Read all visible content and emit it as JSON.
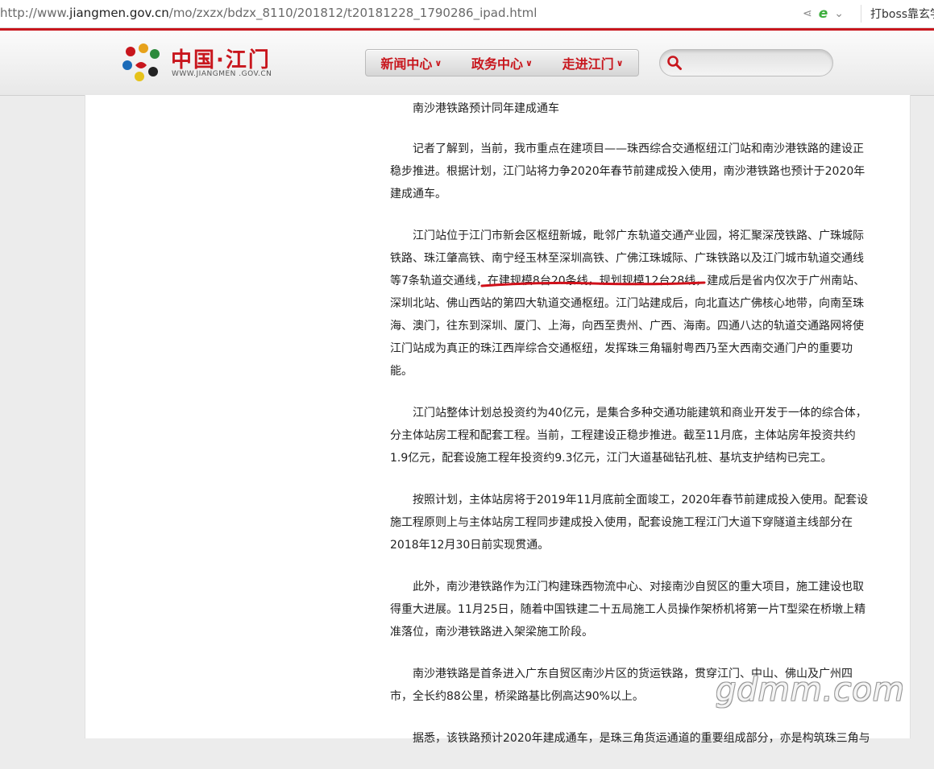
{
  "browser": {
    "url_prefix": "http://www.",
    "url_host": "jiangmen.gov.cn",
    "url_path": "/mo/zxzx/bdzx_8110/201812/t20181228_1790286_ipad.html",
    "right_tab_text": "打boss靠玄学"
  },
  "site": {
    "logo_cn": "中国·江门",
    "logo_en": "WWW.JIANGMEN .GOV.CN",
    "nav": [
      {
        "label": "新闻中心"
      },
      {
        "label": "政务中心"
      },
      {
        "label": "走进江门"
      }
    ],
    "search": {
      "placeholder": ""
    }
  },
  "article": {
    "paragraphs": [
      "南沙港铁路预计同年建成通车",
      "记者了解到，当前，我市重点在建项目——珠西综合交通枢纽江门站和南沙港铁路的建设正稳步推进。根据计划，江门站将力争2020年春节前建成投入使用，南沙港铁路也预计于2020年建成通车。",
      "江门站位于江门市新会区枢纽新城，毗邻广东轨道交通产业园，将汇聚深茂铁路、广珠城际铁路、珠江肇高铁、南宁经玉林至深圳高铁、广佛江珠城际、广珠铁路以及江门城市轨道交通线等7条轨道交通线，在建规模8台20条线，规划规模12台28线，建成后是省内仅次于广州南站、深圳北站、佛山西站的第四大轨道交通枢纽。江门站建成后，向北直达广佛核心地带，向南至珠海、澳门，往东到深圳、厦门、上海，向西至贵州、广西、海南。四通八达的轨道交通路网将使江门站成为真正的珠江西岸综合交通枢纽，发挥珠三角辐射粤西乃至大西南交通门户的重要功能。",
      "江门站整体计划总投资约为40亿元，是集合多种交通功能建筑和商业开发于一体的综合体，分主体站房工程和配套工程。当前，工程建设正稳步推进。截至11月底，主体站房年投资共约1.9亿元，配套设施工程年投资约9.3亿元，江门大道基础钻孔桩、基坑支护结构已完工。",
      "按照计划，主体站房将于2019年11月底前全面竣工，2020年春节前建成投入使用。配套设施工程原则上与主体站房工程同步建成投入使用，配套设施工程江门大道下穿隧道主线部分在2018年12月30日前实现贯通。",
      "此外，南沙港铁路作为江门构建珠西物流中心、对接南沙自贸区的重大项目，施工建设也取得重大进展。11月25日，随着中国铁建二十五局施工人员操作架桥机将第一片T型梁在桥墩上精准落位，南沙港铁路进入架梁施工阶段。",
      "南沙港铁路是首条进入广东自贸区南沙片区的货运铁路，贯穿江门、中山、佛山及广州四市，全长约88公里，桥梁路基比例高达90%以上。",
      "据悉，该铁路预计2020年建成通车，是珠三角货运通道的重要组成部分，亦是构筑珠三角与"
    ]
  },
  "watermark": "gdmm.com",
  "colors": {
    "brand_red": "#c8161d",
    "annotation_red": "#d0101a"
  }
}
